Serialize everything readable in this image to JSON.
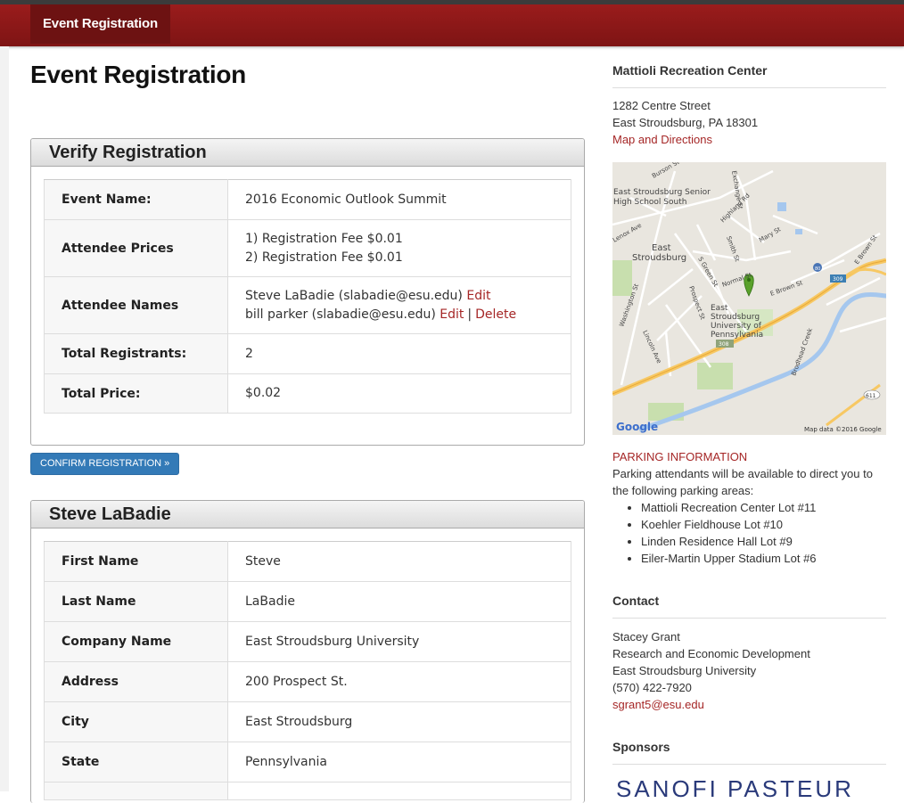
{
  "nav": {
    "brand": "Event Registration"
  },
  "page": {
    "title": "Event Registration"
  },
  "verify": {
    "heading": "Verify Registration",
    "rows": {
      "event_name": {
        "label": "Event Name:",
        "value": "2016 Economic Outlook Summit"
      },
      "attendee_prices": {
        "label": "Attendee Prices",
        "line1": "1) Registration Fee $0.01",
        "line2": "2) Registration Fee $0.01"
      },
      "attendee_names": {
        "label": "Attendee Names",
        "a1_name": "Steve LaBadie (slabadie@esu.edu)",
        "a1_edit": "Edit",
        "a2_name": "bill parker (slabadie@esu.edu)",
        "a2_edit": "Edit",
        "a2_delete": "Delete",
        "separator": "|"
      },
      "total_registrants": {
        "label": "Total Registrants:",
        "value": "2"
      },
      "total_price": {
        "label": "Total Price:",
        "value": "$0.02"
      }
    },
    "confirm_label": "CONFIRM REGISTRATION »"
  },
  "attendee": {
    "heading": "Steve LaBadie",
    "rows": [
      {
        "label": "First Name",
        "value": "Steve"
      },
      {
        "label": "Last Name",
        "value": "LaBadie"
      },
      {
        "label": "Company Name",
        "value": "East Stroudsburg University"
      },
      {
        "label": "Address",
        "value": "200 Prospect St."
      },
      {
        "label": "City",
        "value": "East Stroudsburg"
      },
      {
        "label": "State",
        "value": "Pennsylvania"
      }
    ]
  },
  "sidebar": {
    "venue": {
      "title": "Mattioli Recreation Center",
      "address1": "1282 Centre Street",
      "address2": "East Stroudsburg, PA 18301",
      "map_link": "Map and Directions"
    },
    "map": {
      "labels": {
        "highschool1": "East Stroudsburg Senior",
        "highschool2": "High School South",
        "town1": "East",
        "town2": "Stroudsburg",
        "univ1": "East",
        "univ2": "Stroudsburg",
        "univ3": "University of",
        "univ4": "Pennsylvania",
        "washington": "Washington St",
        "brown": "E Brown St",
        "brown2": "E Brown St",
        "creek": "Brodhead Creek",
        "prospect": "Prospect St",
        "green": "S Green St",
        "smith": "Smith St",
        "highland": "Highland Rd",
        "mary": "Mary St",
        "lenox": "Lenox Ave",
        "exchange": "Exchange St",
        "normal": "Normal St",
        "lincoln": "Lincoln Ave",
        "burson": "Burson St",
        "shield80": "80",
        "shield309": "309",
        "shield308": "308",
        "shield611": "611",
        "google": "Google",
        "attribution": "Map data ©2016 Google"
      }
    },
    "parking": {
      "title": "PARKING INFORMATION",
      "intro": "Parking attendants will be available to direct you to the following parking areas:",
      "lots": [
        "Mattioli Recreation Center Lot #11",
        "Koehler Fieldhouse Lot #10",
        "Linden Residence Hall Lot #9",
        "Eiler-Martin Upper Stadium Lot #6"
      ]
    },
    "contact": {
      "title": "Contact",
      "name": "Stacey Grant",
      "dept": "Research and Economic Development",
      "org": "East Stroudsburg University",
      "phone": "(570) 422-7920",
      "email": "sgrant5@esu.edu"
    },
    "sponsors": {
      "title": "Sponsors",
      "logo_text": "SANOFI PASTEUR"
    }
  },
  "colors": {
    "brand": "#8b1a1a",
    "link": "#a52626",
    "button": "#337ab7"
  }
}
